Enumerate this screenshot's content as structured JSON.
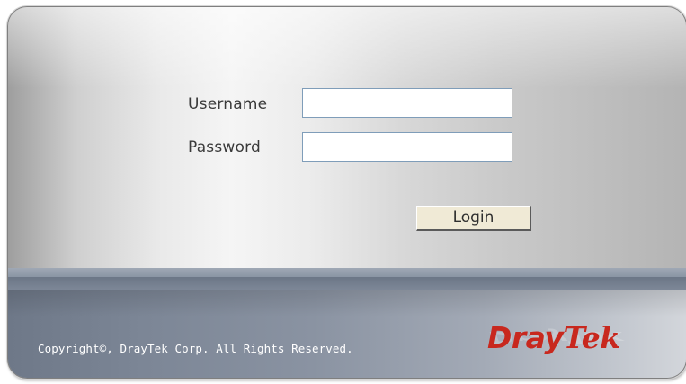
{
  "login_form": {
    "username_label": "Username",
    "password_label": "Password",
    "username_value": "",
    "password_value": "",
    "login_label": "Login"
  },
  "footer": {
    "copyright": "Copyright©, DrayTek Corp. All Rights Reserved.",
    "logo_text_a": "Dray",
    "logo_text_b": "Tek"
  },
  "colors": {
    "brand_red": "#c8281e",
    "footer_blue_gray": "#7c8696",
    "button_bg": "#f0ead6"
  },
  "icons": {
    "brand_logo": "draytek-logo"
  }
}
